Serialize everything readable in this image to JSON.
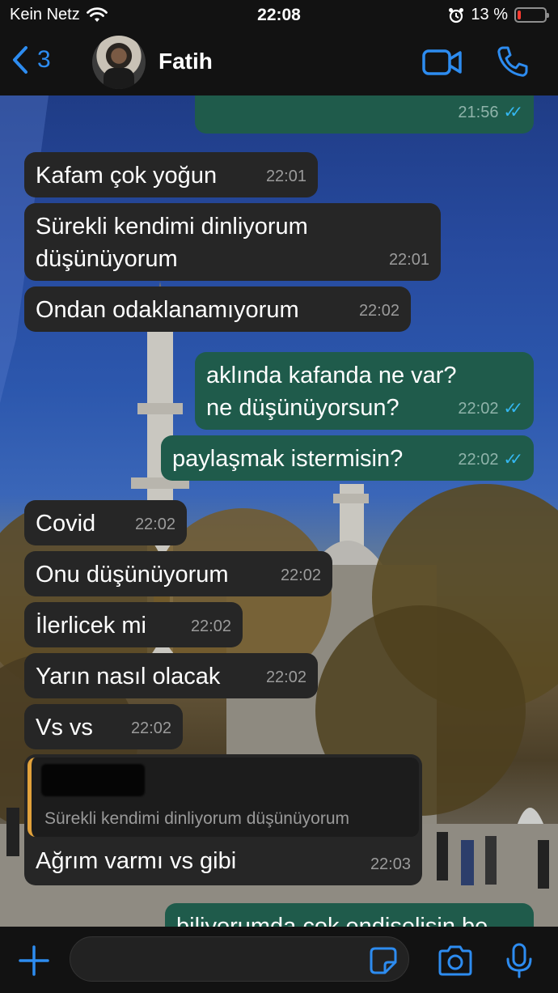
{
  "status_bar": {
    "carrier": "Kein Netz",
    "time": "22:08",
    "battery_percent": "13 %"
  },
  "header": {
    "back_count": "3",
    "contact_name": "Fatih"
  },
  "messages": [
    {
      "direction": "out",
      "text": "",
      "time": "21:56",
      "read": true
    },
    {
      "direction": "in",
      "text": "Kafam çok yoğun",
      "time": "22:01"
    },
    {
      "direction": "in",
      "text": "Sürekli kendimi dinliyorum düşünüyorum",
      "time": "22:01"
    },
    {
      "direction": "in",
      "text": "Ondan odaklanamıyorum",
      "time": "22:02"
    },
    {
      "direction": "out",
      "text": "aklında kafanda ne var? ne düşünüyorsun?",
      "time": "22:02",
      "read": true
    },
    {
      "direction": "out",
      "text": "paylaşmak istermisin?",
      "time": "22:02",
      "read": true
    },
    {
      "direction": "in",
      "text": "Covid",
      "time": "22:02"
    },
    {
      "direction": "in",
      "text": "Onu düşünüyorum",
      "time": "22:02"
    },
    {
      "direction": "in",
      "text": "İlerlicek mi",
      "time": "22:02"
    },
    {
      "direction": "in",
      "text": "Yarın nasıl olacak",
      "time": "22:02"
    },
    {
      "direction": "in",
      "text": "Vs vs",
      "time": "22:02"
    },
    {
      "direction": "in",
      "text": "Ağrım varmı vs gibi",
      "time": "22:03",
      "quoted_text": "Sürekli kendimi dinliyorum düşünüyorum"
    },
    {
      "direction": "out",
      "text": "biliyorumda çok endişelisin be",
      "time": ""
    }
  ],
  "colors": {
    "accent": "#2d8cf0",
    "outgoing_bubble": "#1f5b4b",
    "incoming_bubble": "#262626",
    "read_ticks": "#34b7f1",
    "quote_bar": "#e2a23b"
  },
  "icons": {
    "back": "chevron-left-icon",
    "video_call": "video-camera-icon",
    "voice_call": "phone-icon",
    "attach": "plus-icon",
    "sticker": "sticker-icon",
    "camera": "camera-icon",
    "microphone": "microphone-icon"
  }
}
